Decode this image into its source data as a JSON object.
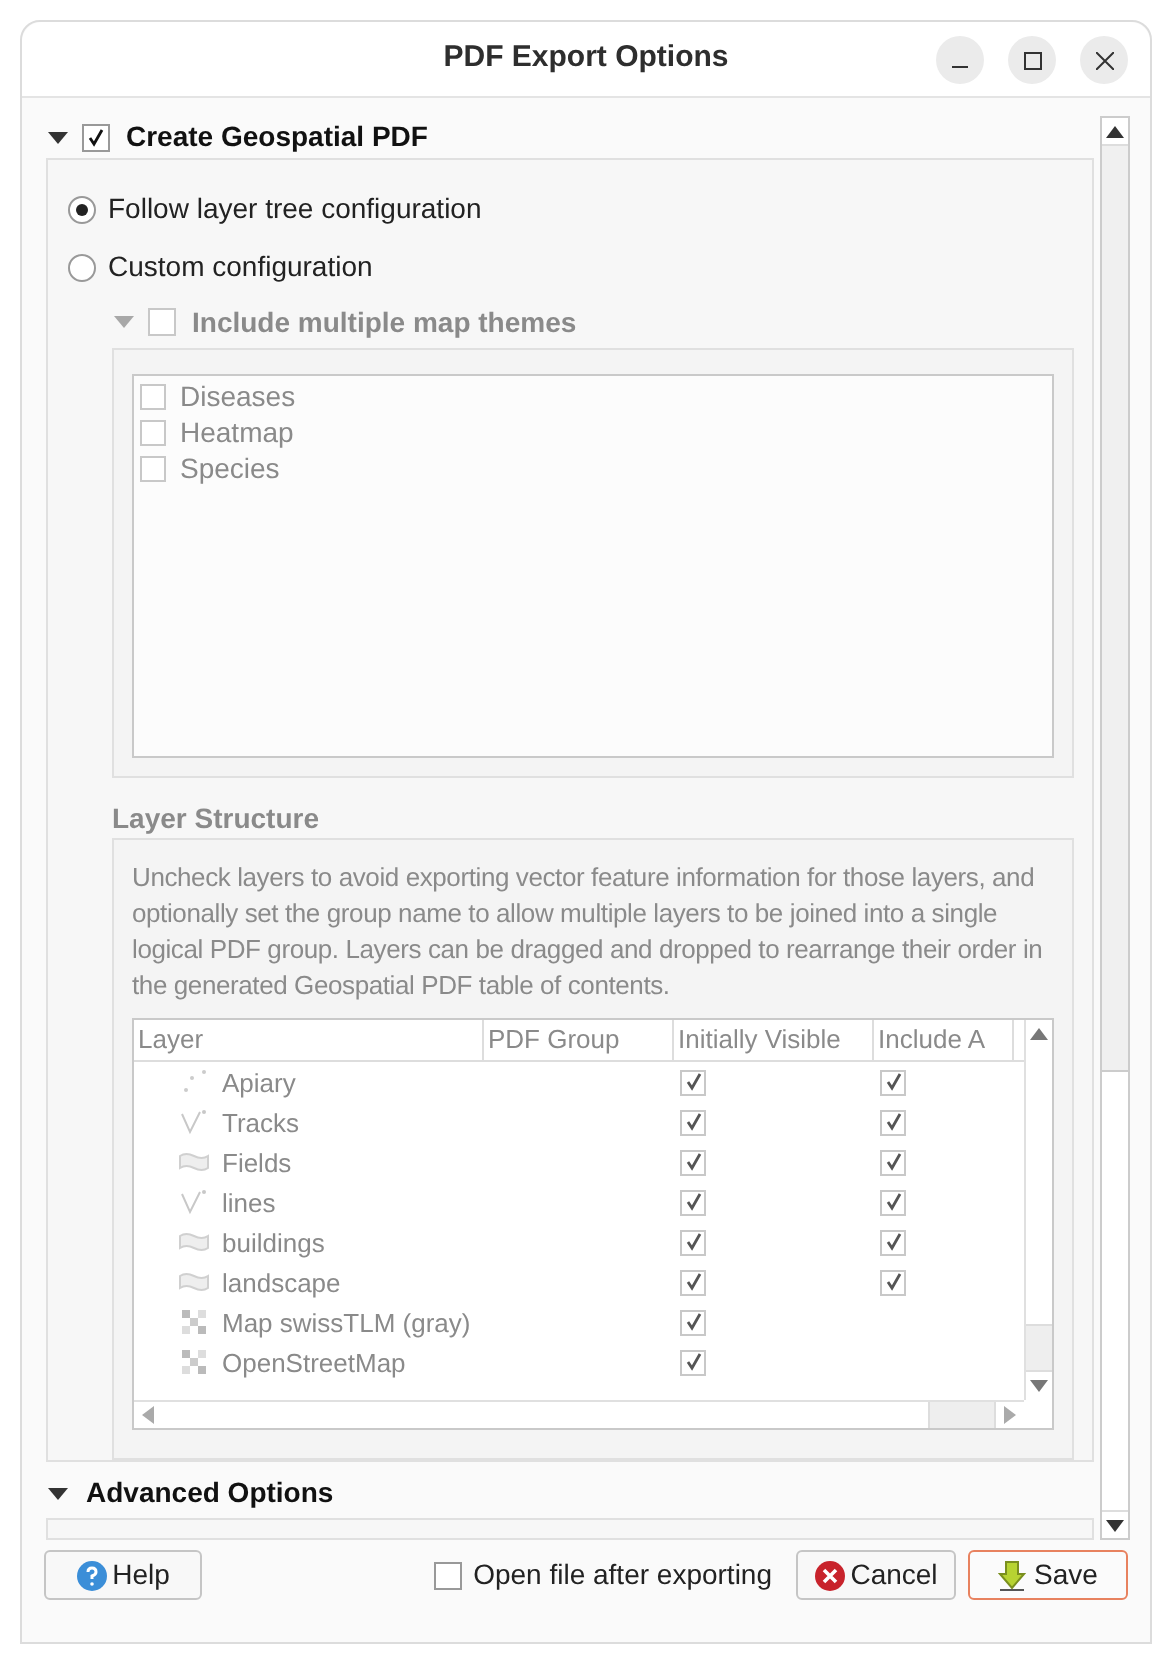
{
  "window": {
    "title": "PDF Export Options"
  },
  "geospatial": {
    "title": "Create Geospatial PDF",
    "expanded": true,
    "checked": true,
    "options": [
      {
        "label": "Follow layer tree configuration",
        "selected": true
      },
      {
        "label": "Custom configuration",
        "selected": false
      }
    ],
    "map_themes": {
      "title": "Include multiple map themes",
      "expanded": true,
      "checked": false,
      "disabled": true,
      "items": [
        {
          "label": "Diseases",
          "checked": false
        },
        {
          "label": "Heatmap",
          "checked": false
        },
        {
          "label": "Species",
          "checked": false
        }
      ]
    },
    "layer_structure": {
      "title": "Layer Structure",
      "disabled": true,
      "description": "Uncheck layers to avoid exporting vector feature information for those layers, and optionally set the group name to allow multiple layers to be joined into a single logical PDF group. Layers can be dragged and dropped to rearrange their order in the generated Geospatial PDF table of contents.",
      "columns": [
        "Layer",
        "PDF Group",
        "Initially Visible",
        "Include A"
      ],
      "rows": [
        {
          "kind": "point",
          "name": "Apiary",
          "initially_visible": true,
          "include_attributes": true
        },
        {
          "kind": "line",
          "name": "Tracks",
          "initially_visible": true,
          "include_attributes": true
        },
        {
          "kind": "polygon",
          "name": "Fields",
          "initially_visible": true,
          "include_attributes": true
        },
        {
          "kind": "line",
          "name": "lines",
          "initially_visible": true,
          "include_attributes": true
        },
        {
          "kind": "polygon",
          "name": "buildings",
          "initially_visible": true,
          "include_attributes": true
        },
        {
          "kind": "polygon",
          "name": "landscape",
          "initially_visible": true,
          "include_attributes": true
        },
        {
          "kind": "raster",
          "name": "Map swissTLM (gray)",
          "initially_visible": true
        },
        {
          "kind": "raster",
          "name": "OpenStreetMap",
          "initially_visible": true
        }
      ]
    }
  },
  "advanced": {
    "title": "Advanced Options",
    "expanded": true
  },
  "footer": {
    "help": "Help",
    "open_after": {
      "label": "Open file after exporting",
      "checked": false
    },
    "cancel": "Cancel",
    "save": "Save"
  }
}
